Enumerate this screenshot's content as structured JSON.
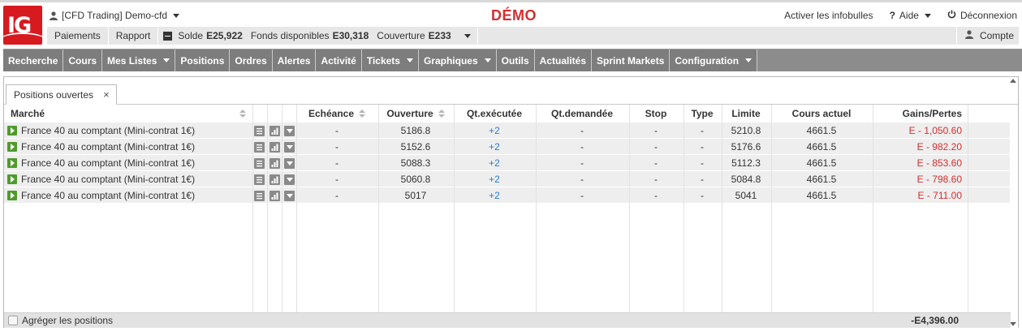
{
  "header": {
    "logo_text": "IG",
    "account_selector": "[CFD Trading] Demo-cfd",
    "demo_label": "DÉMO",
    "infobulles": "Activer les infobulles",
    "help": "Aide",
    "logout": "Déconnexion"
  },
  "account_bar": {
    "payments": "Paiements",
    "report": "Rapport",
    "balance_label": "Solde",
    "balance_value": "E25,922",
    "funds_label": "Fonds disponibles",
    "funds_value": "E30,318",
    "margin_label": "Couverture",
    "margin_value": "E233",
    "account_label": "Compte"
  },
  "nav": {
    "items": [
      {
        "label": "Recherche",
        "dropdown": false
      },
      {
        "label": "Cours",
        "dropdown": false
      },
      {
        "label": "Mes Listes",
        "dropdown": true
      },
      {
        "label": "Positions",
        "dropdown": false
      },
      {
        "label": "Ordres",
        "dropdown": false
      },
      {
        "label": "Alertes",
        "dropdown": false
      },
      {
        "label": "Activité",
        "dropdown": false
      },
      {
        "label": "Tickets",
        "dropdown": true
      },
      {
        "label": "Graphiques",
        "dropdown": true
      },
      {
        "label": "Outils",
        "dropdown": false
      },
      {
        "label": "Actualités",
        "dropdown": false
      },
      {
        "label": "Sprint Markets",
        "dropdown": false
      },
      {
        "label": "Configuration",
        "dropdown": true
      }
    ]
  },
  "panel": {
    "tab_label": "Positions ouvertes",
    "tab_close": "×",
    "columns": {
      "market": "Marché",
      "expiry": "Echéance",
      "opening": "Ouverture",
      "qty_exec": "Qt.exécutée",
      "qty_req": "Qt.demandée",
      "stop": "Stop",
      "type": "Type",
      "limit": "Limite",
      "current": "Cours actuel",
      "pnl": "Gains/Pertes"
    },
    "rows": [
      {
        "market": "France 40 au comptant (Mini-contrat 1€)",
        "expiry": "-",
        "opening": "5186.8",
        "qty_exec": "+2",
        "qty_req": "-",
        "stop": "-",
        "type": "-",
        "limit": "5210.8",
        "current": "4661.5",
        "pnl": "E - 1,050.60"
      },
      {
        "market": "France 40 au comptant (Mini-contrat 1€)",
        "expiry": "-",
        "opening": "5152.6",
        "qty_exec": "+2",
        "qty_req": "-",
        "stop": "-",
        "type": "-",
        "limit": "5176.6",
        "current": "4661.5",
        "pnl": "E - 982.20"
      },
      {
        "market": "France 40 au comptant (Mini-contrat 1€)",
        "expiry": "-",
        "opening": "5088.3",
        "qty_exec": "+2",
        "qty_req": "-",
        "stop": "-",
        "type": "-",
        "limit": "5112.3",
        "current": "4661.5",
        "pnl": "E - 853.60"
      },
      {
        "market": "France 40 au comptant (Mini-contrat 1€)",
        "expiry": "-",
        "opening": "5060.8",
        "qty_exec": "+2",
        "qty_req": "-",
        "stop": "-",
        "type": "-",
        "limit": "5084.8",
        "current": "4661.5",
        "pnl": "E - 798.60"
      },
      {
        "market": "France 40 au comptant (Mini-contrat 1€)",
        "expiry": "-",
        "opening": "5017",
        "qty_exec": "+2",
        "qty_req": "-",
        "stop": "-",
        "type": "-",
        "limit": "5041",
        "current": "4661.5",
        "pnl": "E - 711.00"
      }
    ],
    "aggregate_label": "Agréger les positions",
    "total_pnl": "-E4,396.00"
  },
  "colors": {
    "brand_red": "#d71920",
    "demo_red": "#d32f2f",
    "nav_gray": "#8c8c8c",
    "positive_blue": "#2b7bd4",
    "play_green": "#4f9a2e"
  }
}
